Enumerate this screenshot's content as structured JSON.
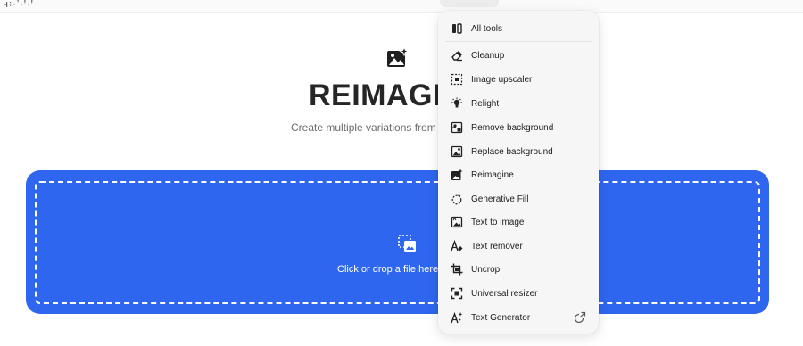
{
  "topbar": {
    "logo_text": "ꟶ꞉·ʼ·ꞌ·ꞌ"
  },
  "hero": {
    "title": "REIMAGI",
    "subtitle": "Create multiple variations from a"
  },
  "dropzone": {
    "text": "Click or drop a file here t"
  },
  "menu": {
    "items": [
      {
        "label": "All tools",
        "icon": "all-tools-icon"
      },
      {
        "label": "Cleanup",
        "icon": "eraser-icon"
      },
      {
        "label": "Image upscaler",
        "icon": "upscale-icon"
      },
      {
        "label": "Relight",
        "icon": "bulb-icon"
      },
      {
        "label": "Remove background",
        "icon": "remove-bg-icon"
      },
      {
        "label": "Replace background",
        "icon": "replace-bg-icon"
      },
      {
        "label": "Reimagine",
        "icon": "reimagine-icon"
      },
      {
        "label": "Generative Fill",
        "icon": "generative-fill-icon"
      },
      {
        "label": "Text to image",
        "icon": "text-to-image-icon"
      },
      {
        "label": "Text remover",
        "icon": "text-remover-icon"
      },
      {
        "label": "Uncrop",
        "icon": "uncrop-icon"
      },
      {
        "label": "Universal resizer",
        "icon": "resizer-icon"
      },
      {
        "label": "Text Generator",
        "icon": "text-generator-icon",
        "external": true
      }
    ]
  },
  "colors": {
    "accent": "#2e66f0",
    "menu_bg": "#f6f6f6",
    "text": "#202020"
  }
}
